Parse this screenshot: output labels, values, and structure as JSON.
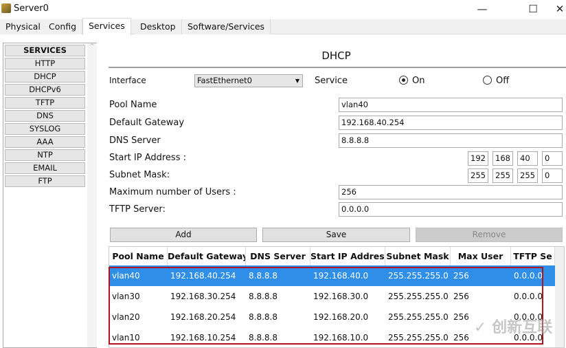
{
  "window": {
    "title": "Server0",
    "minimize": "—",
    "maximize": "☐",
    "close": "✕"
  },
  "tabs": [
    "Physical",
    "Config",
    "Services",
    "Desktop",
    "Software/Services"
  ],
  "active_tab": "Services",
  "services": {
    "header": "SERVICES",
    "items": [
      "HTTP",
      "DHCP",
      "DHCPv6",
      "TFTP",
      "DNS",
      "SYSLOG",
      "AAA",
      "NTP",
      "EMAIL",
      "FTP"
    ]
  },
  "dhcp": {
    "title": "DHCP",
    "interface_label": "Interface",
    "interface_value": "FastEthernet0",
    "service_label": "Service",
    "on_label": "On",
    "off_label": "Off",
    "service_state": "On",
    "pool_name_label": "Pool Name",
    "pool_name": "vlan40",
    "gateway_label": "Default Gateway",
    "gateway": "192.168.40.254",
    "dns_label": "DNS Server",
    "dns": "8.8.8.8",
    "start_ip_label": "Start IP Address :",
    "start_ip": [
      "192",
      "168",
      "40",
      "0"
    ],
    "subnet_label": "Subnet Mask:",
    "subnet": [
      "255",
      "255",
      "255",
      "0"
    ],
    "max_users_label": "Maximum number of Users :",
    "max_users": "256",
    "tftp_label": "TFTP Server:",
    "tftp": "0.0.0.0",
    "add": "Add",
    "save": "Save",
    "remove": "Remove"
  },
  "table": {
    "columns": [
      "Pool Name",
      "Default Gateway",
      "DNS Server",
      "Start IP Address",
      "Subnet Mask",
      "Max User",
      "TFTP Se"
    ],
    "rows": [
      [
        "vlan40",
        "192.168.40.254",
        "8.8.8.8",
        "192.168.40.0",
        "255.255.255.0",
        "256",
        "0.0.0.0"
      ],
      [
        "vlan30",
        "192.168.30.254",
        "8.8.8.8",
        "192.168.30.0",
        "255.255.255.0",
        "256",
        "0.0.0.0"
      ],
      [
        "vlan20",
        "192.168.20.254",
        "8.8.8.8",
        "192.168.20.0",
        "255.255.255.0",
        "256",
        "0.0.0.0"
      ],
      [
        "vlan10",
        "192.168.10.254",
        "8.8.8.8",
        "192.168.10.0",
        "255.255.255.0",
        "256",
        "0.0.0.0"
      ]
    ],
    "selected_row": 0
  },
  "watermark": "创新互联",
  "colors": {
    "selection": "#2f8fe8",
    "highlight_box": "#b0141e"
  }
}
